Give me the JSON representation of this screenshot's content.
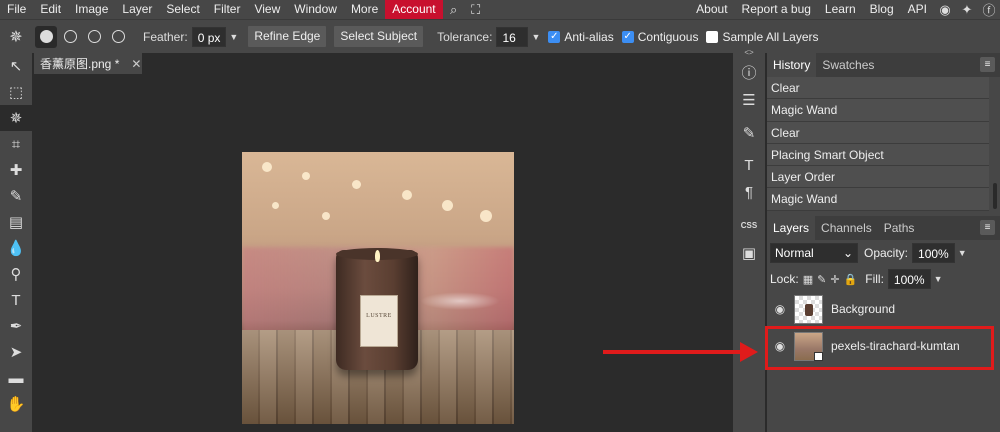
{
  "menu": {
    "items": [
      "File",
      "Edit",
      "Image",
      "Layer",
      "Select",
      "Filter",
      "View",
      "Window",
      "More"
    ],
    "account": "Account",
    "right_links": [
      "About",
      "Report a bug",
      "Learn",
      "Blog",
      "API"
    ]
  },
  "options": {
    "feather_label": "Feather:",
    "feather_value": "0 px",
    "refine_edge": "Refine Edge",
    "select_subject": "Select Subject",
    "tolerance_label": "Tolerance:",
    "tolerance_value": "16",
    "anti_alias": "Anti-alias",
    "anti_alias_checked": true,
    "contiguous": "Contiguous",
    "contiguous_checked": true,
    "sample_all": "Sample All Layers",
    "sample_all_checked": false
  },
  "document": {
    "tab_name": "香薰原图.png *",
    "jar_label": "LUSTRE"
  },
  "history": {
    "tabs": [
      "History",
      "Swatches"
    ],
    "items": [
      "Clear",
      "Magic Wand",
      "Clear",
      "Placing Smart Object",
      "Layer Order",
      "Magic Wand"
    ]
  },
  "layers_panel": {
    "tabs": [
      "Layers",
      "Channels",
      "Paths"
    ],
    "blend_mode": "Normal",
    "opacity_label": "Opacity:",
    "opacity_value": "100%",
    "lock_label": "Lock:",
    "fill_label": "Fill:",
    "fill_value": "100%",
    "layers": [
      {
        "name": "Background"
      },
      {
        "name": "pexels-tirachard-kumtan"
      }
    ]
  },
  "accent_colors": {
    "account": "#c8102e",
    "annotation": "#e01b1b",
    "checkbox": "#3c8ef3"
  }
}
